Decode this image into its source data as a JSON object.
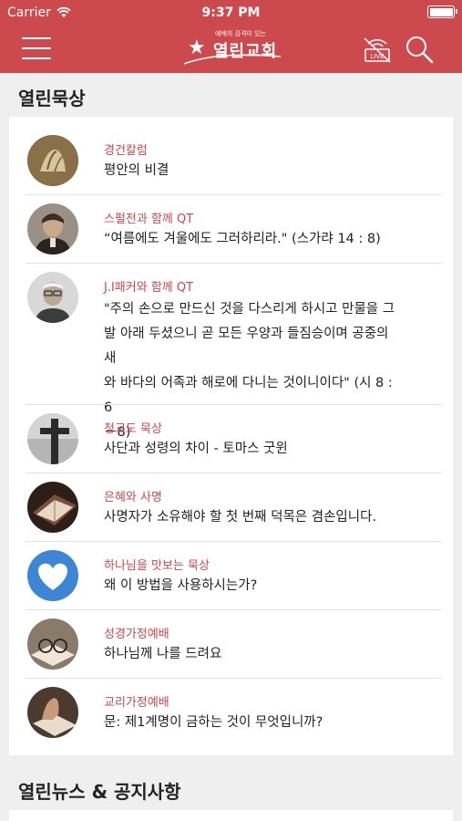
{
  "status_bar": {
    "carrier": "Carrier",
    "time": "9:37 PM"
  },
  "header": {
    "logo_tagline": "예배의 감격이 있는",
    "logo_name": "열린교회",
    "live_label": "LIVE",
    "brand_color": "#cc4a4d",
    "icons": [
      "menu-icon",
      "logo-star-icon",
      "live-off-icon",
      "search-icon"
    ]
  },
  "sections": {
    "devotion_title": "열린묵상",
    "news_title": "열린뉴스 & 공지사항"
  },
  "devotions": [
    {
      "category": "경건칼럼",
      "title": "평안의 비결",
      "thumb": "praying-hands"
    },
    {
      "category": "스펄전과 함께 QT",
      "title": "“여름에도 겨울에도 그러하리라.\" (스가랴 14 : 8)",
      "thumb": "spurgeon-portrait"
    },
    {
      "category": "J.I패커와 함께 QT",
      "title_lines": [
        "\"주의 손으로 만드신 것을 다스리게 하시고 만물을 그",
        "발 아래 두셨으니 곧 모든 우양과 들짐승이며 공중의 새",
        "와 바다의 어족과 해로에 다니는 것이니이다\" (시 8 : 6",
        "－8)"
      ],
      "thumb": "packer-portrait"
    },
    {
      "category": "청교도 묵상",
      "title": "사단과 성령의 차이 - 토마스 굿윈",
      "thumb": "cross"
    },
    {
      "category": "은혜와 사명",
      "title": "사명자가 소유해야 할 첫 번째 덕목은 겸손입니다.",
      "thumb": "bible"
    },
    {
      "category": "하나님을 맛보는 묵상",
      "title": "왜 이 방법을 사용하시는가?",
      "thumb": "heart-cloud"
    },
    {
      "category": "성경가정예배",
      "title": "하나님께 나를 드려요",
      "thumb": "glasses-book"
    },
    {
      "category": "교리가정예배",
      "title": "문: 제1계명이 금하는 것이 무엇입니까?",
      "thumb": "prayer-book"
    }
  ]
}
